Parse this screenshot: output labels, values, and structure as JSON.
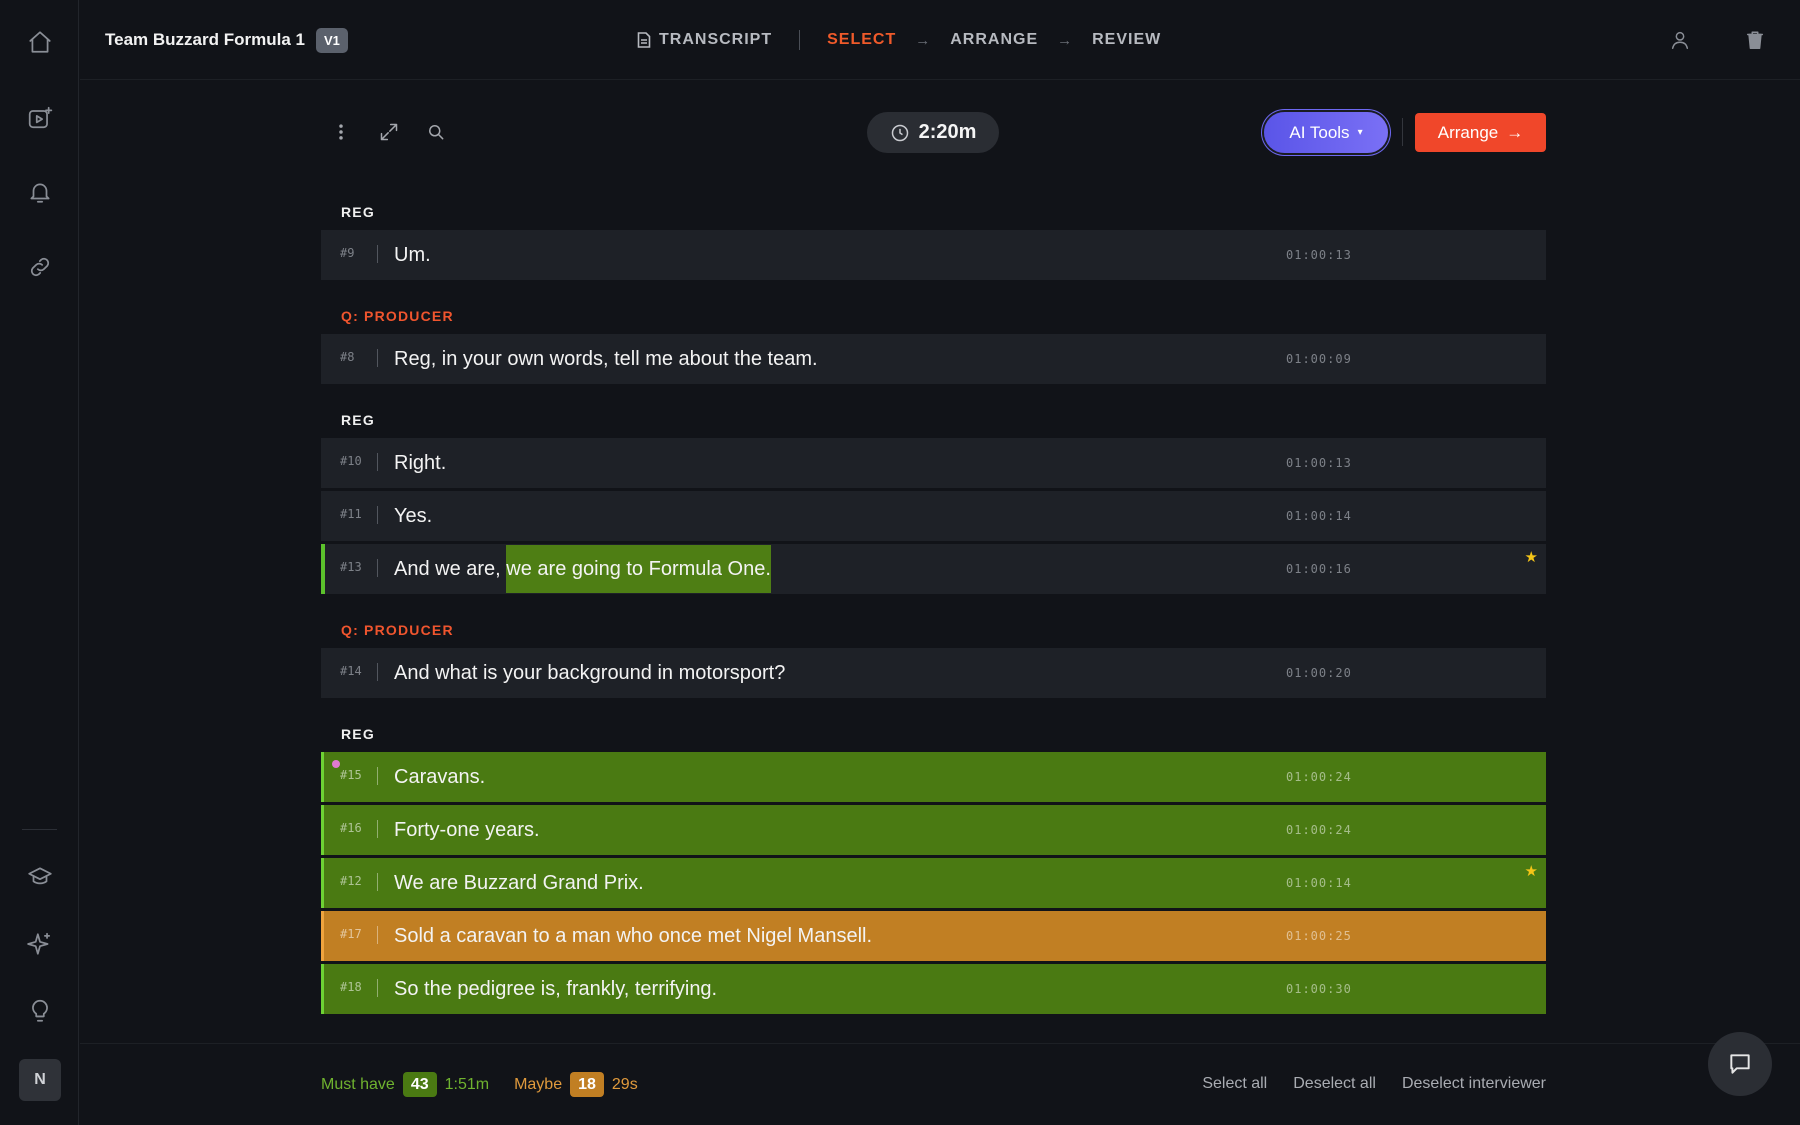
{
  "project": {
    "title": "Team Buzzard Formula 1",
    "version": "V1"
  },
  "steps": {
    "transcript": "TRANSCRIPT",
    "select": "SELECT",
    "arrange": "ARRANGE",
    "review": "REVIEW",
    "active": "SELECT"
  },
  "toolbar": {
    "duration": "2:20m",
    "ai_tools_label": "AI Tools",
    "arrange_label": "Arrange"
  },
  "colors": {
    "accent": "#f0472a",
    "must_have": "#4a7a12",
    "maybe": "#c17f23",
    "ai": "#6d68f0"
  },
  "sidebar": {
    "icons": [
      "home-icon",
      "video-add-icon",
      "bell-icon",
      "link-icon",
      "graduation-cap-icon",
      "sparkle-icon",
      "lightbulb-icon"
    ],
    "avatar_initial": "N"
  },
  "groups": [
    {
      "speaker": "REG",
      "rows": [
        {
          "num": "#9",
          "text": "Um.",
          "time": "01:00:13"
        }
      ]
    },
    {
      "speaker": "Q: PRODUCER",
      "rows": [
        {
          "num": "#8",
          "text": "Reg, in your own words, tell me about the team.",
          "time": "01:00:09"
        }
      ]
    },
    {
      "speaker": "REG",
      "rows": [
        {
          "num": "#10",
          "text": "Right.",
          "time": "01:00:13"
        },
        {
          "num": "#11",
          "text": "Yes.",
          "time": "01:00:14"
        },
        {
          "num": "#13",
          "text_before": "And we are, ",
          "text_highlight": "we are going to Formula One.",
          "time": "01:00:16",
          "starred": true
        }
      ]
    },
    {
      "speaker": "Q: PRODUCER",
      "rows": [
        {
          "num": "#14",
          "text": "And what is your background in motorsport?",
          "time": "01:00:20"
        }
      ]
    },
    {
      "speaker": "REG",
      "rows": [
        {
          "num": "#15",
          "text": "Caravans.",
          "time": "01:00:24",
          "status": "must-have"
        },
        {
          "num": "#16",
          "text": "Forty-one years.",
          "time": "01:00:24",
          "status": "must-have"
        },
        {
          "num": "#12",
          "text": "We are Buzzard Grand Prix.",
          "time": "01:00:14",
          "status": "must-have",
          "starred": true
        },
        {
          "num": "#17",
          "text": "Sold a caravan to a man who once met Nigel Mansell.",
          "time": "01:00:25",
          "status": "maybe"
        },
        {
          "num": "#18",
          "text": "So the pedigree is, frankly, terrifying.",
          "time": "01:00:30",
          "status": "must-have"
        }
      ]
    }
  ],
  "footer": {
    "must_have_label": "Must have",
    "must_have_count": "43",
    "must_have_time": "1:51m",
    "maybe_label": "Maybe",
    "maybe_count": "18",
    "maybe_time": "29s",
    "select_all": "Select all",
    "deselect_all": "Deselect all",
    "deselect_interviewer": "Deselect interviewer"
  }
}
